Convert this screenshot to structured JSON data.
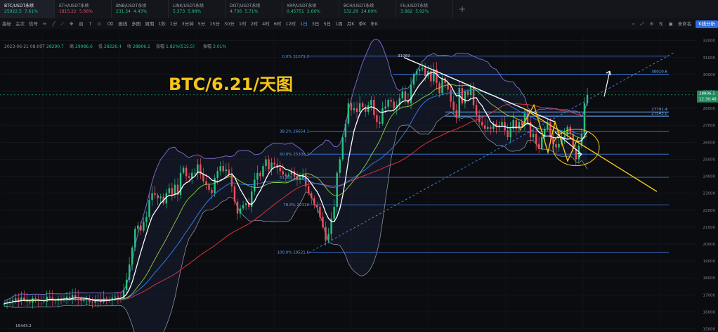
{
  "tabs": [
    {
      "symbol": "BTC/USDT永续",
      "price": "25922.5",
      "change": "7.61%",
      "dir": "up",
      "active": true
    },
    {
      "symbol": "ETH/USDT永续",
      "price": "1815.22",
      "change": "5.66%",
      "dir": "dn",
      "active": false
    },
    {
      "symbol": "BNB/USDT永续",
      "price": "231.54",
      "change": "4.43%",
      "dir": "up",
      "active": false
    },
    {
      "symbol": "LINK/USDT永续",
      "price": "5.373",
      "change": "5.98%",
      "dir": "up",
      "active": false
    },
    {
      "symbol": "DOT/USDT永续",
      "price": "4.736",
      "change": "5.71%",
      "dir": "up",
      "active": false
    },
    {
      "symbol": "XRP/USDT永续",
      "price": "0.45751",
      "change": "2.66%",
      "dir": "up",
      "active": false
    },
    {
      "symbol": "BCH/USDT永续",
      "price": "132.29",
      "change": "24.60%",
      "dir": "up",
      "active": false
    },
    {
      "symbol": "FIL/USDT永续",
      "price": "3.682",
      "change": "5.92%",
      "dir": "up",
      "active": false
    }
  ],
  "toolbar": {
    "items": [
      "指标",
      "主次",
      "信号",
      "画线",
      "多图",
      "周期",
      "1秒",
      "1分",
      "3分钟",
      "5分",
      "15分",
      "30分",
      "1时",
      "2时",
      "4时",
      "6时",
      "12时",
      "1日",
      "3日",
      "5日",
      "1周",
      "月K",
      "季K",
      "年K"
    ],
    "selected": "1日",
    "right_a": "未命名",
    "kline_btn": "K线分析"
  },
  "info": {
    "date": "2023-06-21 08:00",
    "open_label": "开",
    "open": "28290.7",
    "high_label": "高",
    "high": "29086.6",
    "low_label": "低",
    "low": "28226.4",
    "close_label": "收",
    "close": "28806.1",
    "chg_label": "涨幅",
    "chg": "1.82%(515.5)",
    "amp_label": "振幅",
    "amp": "3.01%"
  },
  "annotation": "BTC/6.21/天图",
  "colors": {
    "up": "#26c281",
    "down": "#ef4d5b",
    "fib": "#3a7be0",
    "fib_text": "#5b9cf5",
    "yellow": "#f5c518",
    "white": "#ffffff",
    "bb": "#7566c8"
  },
  "chart_data": {
    "type": "candlestick",
    "yaxis_ticks": [
      32000,
      31000,
      30000,
      29000,
      28000,
      27000,
      26000,
      25000,
      24000,
      23000,
      22000,
      21000,
      20000,
      19000,
      18000,
      17000,
      16000,
      15000
    ],
    "ylim": [
      14900,
      32400
    ],
    "current_price": "28806.1",
    "current_time": "12:30:48",
    "high_marker": "31069",
    "low_marker": "15443.2",
    "fib_levels": [
      {
        "label": "0.0% 31079.0",
        "value": 31079
      },
      {
        "label": "38.2% 26654.1",
        "value": 26654
      },
      {
        "label": "50.0% 25300.3",
        "value": 25300
      },
      {
        "label": "61.8% 23936.5",
        "value": 23936
      },
      {
        "label": "78.6% 22318",
        "value": 22318
      },
      {
        "label": "100.0% 19521.6",
        "value": 19521
      }
    ],
    "extra_levels": [
      {
        "label": "30010.6",
        "value": 30010
      },
      {
        "label": "27791.4",
        "value": 27791
      },
      {
        "label": "27543.0",
        "value": 27543
      }
    ],
    "closes": [
      16500,
      16550,
      16600,
      16700,
      16800,
      16650,
      16850,
      16700,
      16600,
      16550,
      16800,
      16750,
      16700,
      16650,
      16600,
      16900,
      16850,
      16700,
      16650,
      16800,
      16700,
      16750,
      16900,
      16800,
      17000,
      16850,
      16800,
      16650,
      16700,
      16750,
      16600,
      16550,
      16650,
      16700,
      16600,
      16800,
      16750,
      16700,
      16850,
      16900,
      16850,
      16800,
      17300,
      17900,
      18800,
      19800,
      20900,
      21100,
      20800,
      21300,
      21600,
      22600,
      23000,
      22900,
      22700,
      22800,
      22400,
      23000,
      23300,
      22900,
      23500,
      22900,
      24200,
      24500,
      24000,
      23900,
      24200,
      24200,
      24700,
      24100,
      23700,
      23500,
      23200,
      23000,
      23900,
      24300,
      24600,
      24300,
      24400,
      24100,
      23400,
      22500,
      21800,
      22100,
      22300,
      22400,
      22200,
      23100,
      23800,
      24200,
      24000,
      24600,
      25000,
      24400,
      24800,
      24700,
      24500,
      24300,
      24100,
      24000,
      24100,
      24300,
      24000,
      23800,
      23900,
      24100,
      23400,
      23000,
      22700,
      22300,
      22200,
      21600,
      21000,
      20200,
      20600,
      21500,
      22200,
      24200,
      25000,
      26300,
      27100,
      28300,
      27900,
      28000,
      27800,
      28300,
      28100,
      27800,
      28200,
      28500,
      27600,
      27200,
      27100,
      28000,
      28100,
      28500,
      28400,
      28000,
      28200,
      28600,
      29000,
      28500,
      28300,
      29400,
      30000,
      30200,
      30300,
      30400,
      29900,
      30200,
      29600,
      30300,
      29500,
      28900,
      29800,
      29500,
      29100,
      28400,
      27900,
      27500,
      29200,
      28300,
      29000,
      28800,
      29300,
      28200,
      27600,
      27200,
      27000,
      26800,
      26900,
      26800,
      27100,
      26900,
      27000,
      27200,
      26700,
      26300,
      26800,
      27300,
      26800,
      27200,
      27000,
      27700,
      27200,
      26300,
      26500,
      25900,
      25600,
      26300,
      26800,
      27200,
      26300,
      25900,
      25700,
      25900,
      26200,
      26400,
      26900,
      26500,
      25600,
      25000,
      25800,
      26500,
      28300,
      28806
    ]
  }
}
